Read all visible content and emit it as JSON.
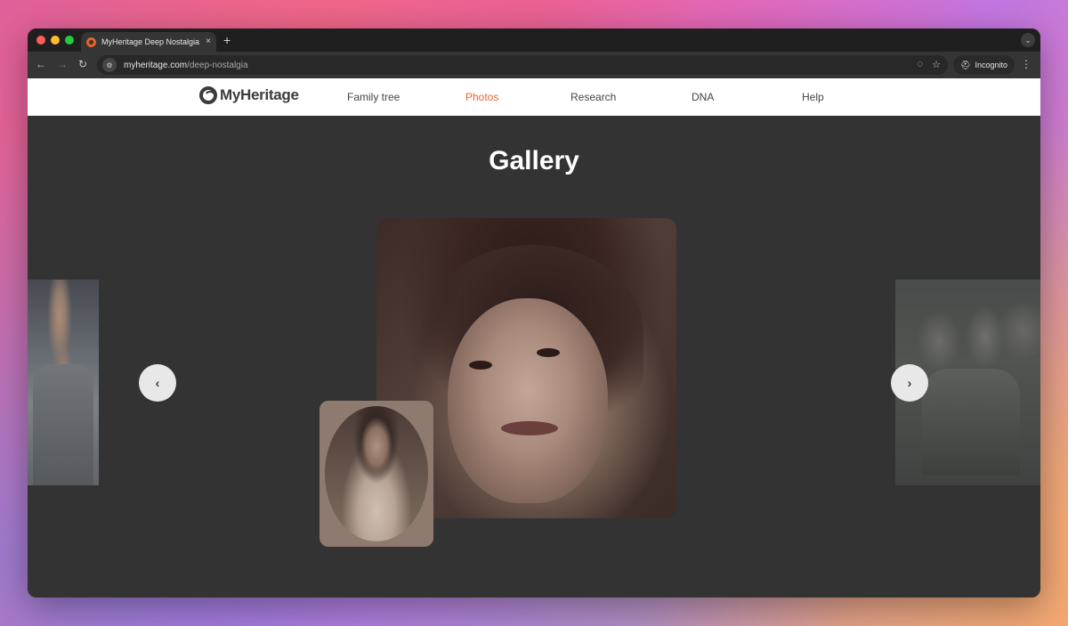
{
  "browser": {
    "tab_title": "MyHeritage Deep Nostalgia™",
    "tab_close": "×",
    "new_tab": "+",
    "url_domain": "myheritage.com",
    "url_path": "/deep-nostalgia",
    "incognito_label": "Incognito"
  },
  "header": {
    "logo_text": "MyHeritage",
    "nav": [
      {
        "label": "Family tree"
      },
      {
        "label": "Photos",
        "active": true
      },
      {
        "label": "Research"
      },
      {
        "label": "DNA"
      },
      {
        "label": "Help"
      }
    ]
  },
  "gallery": {
    "title": "Gallery",
    "prev_label": "‹",
    "next_label": "›"
  },
  "colors": {
    "accent": "#f0622b",
    "content_bg": "#333333",
    "header_bg": "#ffffff"
  },
  "icons": [
    "back-icon",
    "forward-icon",
    "reload-icon",
    "site-info-icon",
    "eye-off-icon",
    "star-icon",
    "incognito-icon",
    "menu-icon"
  ]
}
